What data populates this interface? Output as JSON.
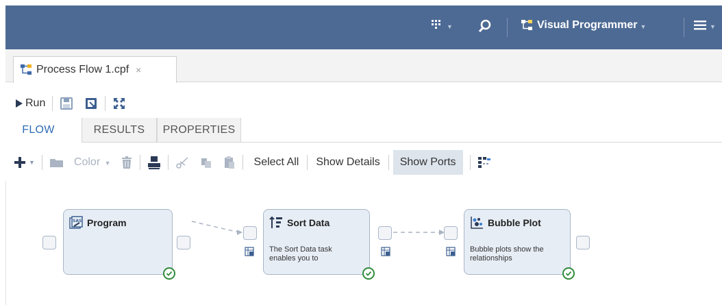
{
  "header": {
    "apps_icon": "apps-grid-icon",
    "search_icon": "search-icon",
    "perspective_label": "Visual Programmer",
    "menu_icon": "menu-icon",
    "color": "#4d6a94"
  },
  "document_tab": {
    "title": "Process Flow 1.cpf",
    "close": "×",
    "icon": "process-flow-icon"
  },
  "run_toolbar": {
    "run_label": "Run",
    "icons": [
      "save-icon",
      "save-as-icon",
      "maximize-icon"
    ]
  },
  "view_tabs": [
    {
      "label": "FLOW",
      "active": true
    },
    {
      "label": "RESULTS",
      "active": false
    },
    {
      "label": "PROPERTIES",
      "active": false
    }
  ],
  "flow_toolbar": {
    "add_icon": "plus-icon",
    "open_icon": "folder-icon",
    "color_label": "Color",
    "delete_icon": "trash-icon",
    "print_icon": "printer-icon",
    "cut_icon": "scissors-icon",
    "copy_icon": "copy-icon",
    "paste_icon": "paste-icon",
    "select_all_label": "Select All",
    "show_details_label": "Show Details",
    "show_ports_label": "Show Ports",
    "arrange_icon": "arrange-icon",
    "active_bg": "#dde4ec"
  },
  "nodes": [
    {
      "title": "Program",
      "icon": "program-icon",
      "description": "",
      "status": "success"
    },
    {
      "title": "Sort Data",
      "icon": "sort-icon",
      "description": "The Sort Data task enables you to",
      "status": "success"
    },
    {
      "title": "Bubble Plot",
      "icon": "bubble-plot-icon",
      "description": "Bubble plots show the relationships",
      "status": "success"
    }
  ],
  "status_color": "#2f8a3a"
}
